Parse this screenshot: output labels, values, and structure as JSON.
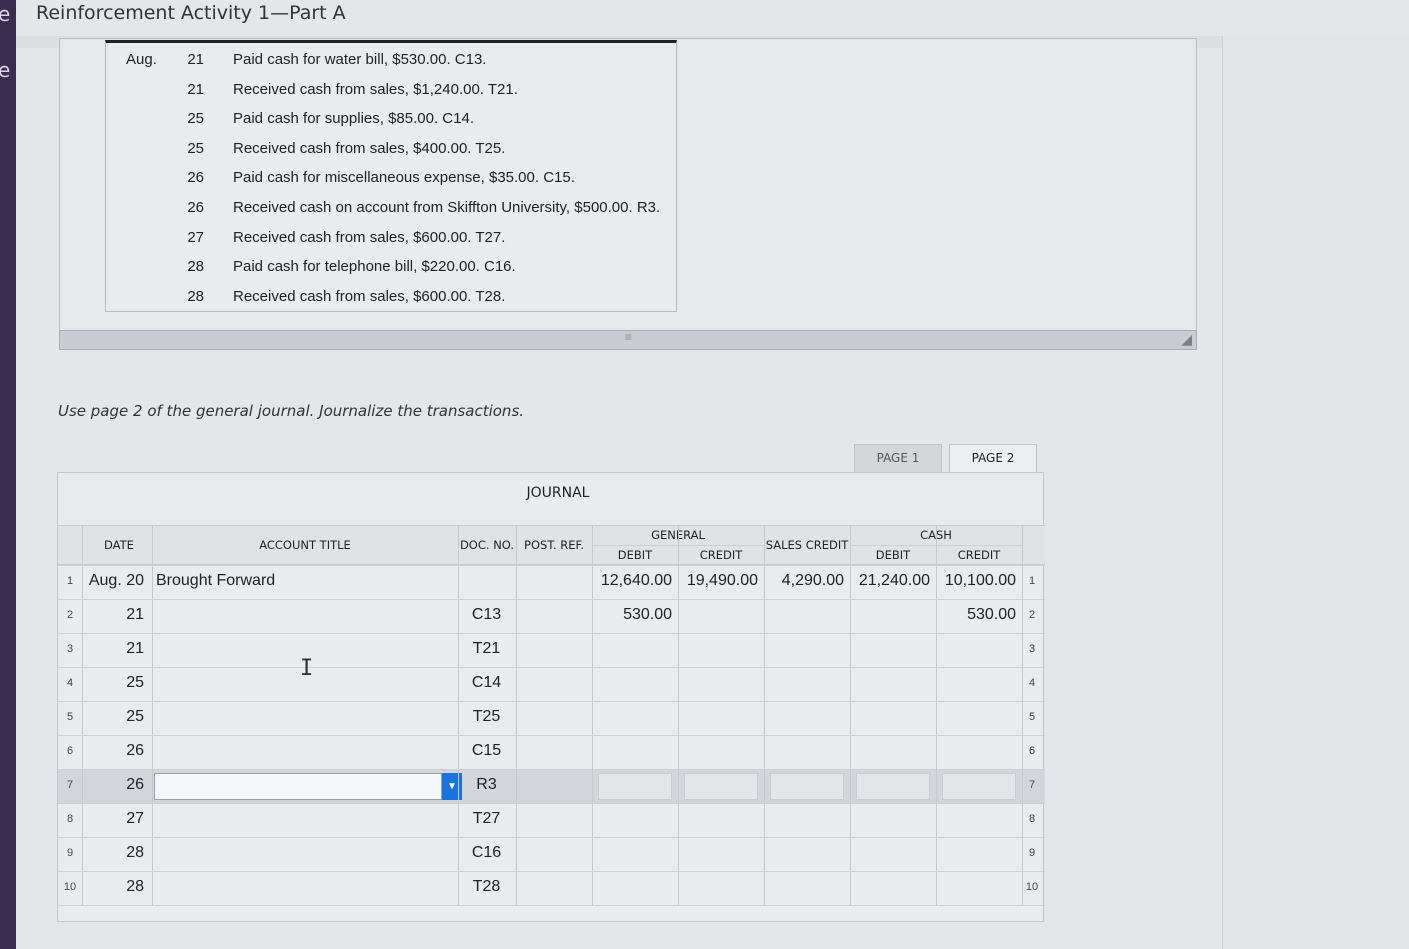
{
  "app": {
    "title": "Reinforcement Activity 1—Part A",
    "edge_glyphs": [
      "e",
      "e"
    ]
  },
  "transactions": [
    {
      "month": "Aug.",
      "day": "21",
      "text": "Paid cash for water bill, $530.00. C13."
    },
    {
      "month": "",
      "day": "21",
      "text": "Received cash from sales, $1,240.00. T21."
    },
    {
      "month": "",
      "day": "25",
      "text": "Paid cash for supplies, $85.00. C14."
    },
    {
      "month": "",
      "day": "25",
      "text": "Received cash from sales, $400.00. T25."
    },
    {
      "month": "",
      "day": "26",
      "text": "Paid cash for miscellaneous expense, $35.00. C15."
    },
    {
      "month": "",
      "day": "26",
      "text": "Received cash on account from Skiffton University, $500.00. R3."
    },
    {
      "month": "",
      "day": "27",
      "text": "Received cash from sales, $600.00. T27."
    },
    {
      "month": "",
      "day": "28",
      "text": "Paid cash for telephone bill, $220.00. C16."
    },
    {
      "month": "",
      "day": "28",
      "text": "Received cash from sales, $600.00. T28."
    }
  ],
  "instruction": "Use page 2 of the general journal. Journalize the transactions.",
  "tabs": [
    {
      "label": "PAGE 1",
      "active": false
    },
    {
      "label": "PAGE 2",
      "active": true
    }
  ],
  "journal": {
    "title": "JOURNAL",
    "headers": {
      "date": "DATE",
      "account_title": "ACCOUNT TITLE",
      "doc_no": "DOC. NO.",
      "post_ref": "POST. REF.",
      "general": "GENERAL",
      "general_debit": "DEBIT",
      "general_credit": "CREDIT",
      "sales_credit": "SALES CREDIT",
      "cash": "CASH",
      "cash_debit": "DEBIT",
      "cash_credit": "CREDIT"
    },
    "rows": [
      {
        "n": "1",
        "date": "Aug. 20",
        "account": "Brought Forward",
        "doc": "",
        "gen_debit": "12,640.00",
        "gen_credit": "19,490.00",
        "sales_credit": "4,290.00",
        "cash_debit": "21,240.00",
        "cash_credit": "10,100.00"
      },
      {
        "n": "2",
        "date": "21",
        "account": "",
        "doc": "C13",
        "gen_debit": "530.00",
        "gen_credit": "",
        "sales_credit": "",
        "cash_debit": "",
        "cash_credit": "530.00"
      },
      {
        "n": "3",
        "date": "21",
        "account": "",
        "doc": "T21",
        "gen_debit": "",
        "gen_credit": "",
        "sales_credit": "",
        "cash_debit": "",
        "cash_credit": ""
      },
      {
        "n": "4",
        "date": "25",
        "account": "",
        "doc": "C14",
        "gen_debit": "",
        "gen_credit": "",
        "sales_credit": "",
        "cash_debit": "",
        "cash_credit": ""
      },
      {
        "n": "5",
        "date": "25",
        "account": "",
        "doc": "T25",
        "gen_debit": "",
        "gen_credit": "",
        "sales_credit": "",
        "cash_debit": "",
        "cash_credit": ""
      },
      {
        "n": "6",
        "date": "26",
        "account": "",
        "doc": "C15",
        "gen_debit": "",
        "gen_credit": "",
        "sales_credit": "",
        "cash_debit": "",
        "cash_credit": ""
      },
      {
        "n": "7",
        "date": "26",
        "account": "",
        "doc": "R3",
        "gen_debit": "",
        "gen_credit": "",
        "sales_credit": "",
        "cash_debit": "",
        "cash_credit": "",
        "active": true
      },
      {
        "n": "8",
        "date": "27",
        "account": "",
        "doc": "T27",
        "gen_debit": "",
        "gen_credit": "",
        "sales_credit": "",
        "cash_debit": "",
        "cash_credit": ""
      },
      {
        "n": "9",
        "date": "28",
        "account": "",
        "doc": "C16",
        "gen_debit": "",
        "gen_credit": "",
        "sales_credit": "",
        "cash_debit": "",
        "cash_credit": ""
      },
      {
        "n": "10",
        "date": "28",
        "account": "",
        "doc": "T28",
        "gen_debit": "",
        "gen_credit": "",
        "sales_credit": "",
        "cash_debit": "",
        "cash_credit": ""
      }
    ]
  },
  "colors": {
    "dropdown_accent": "#1a73d9",
    "active_row": "#d2d6da",
    "left_edge": "#3a2d4f"
  }
}
